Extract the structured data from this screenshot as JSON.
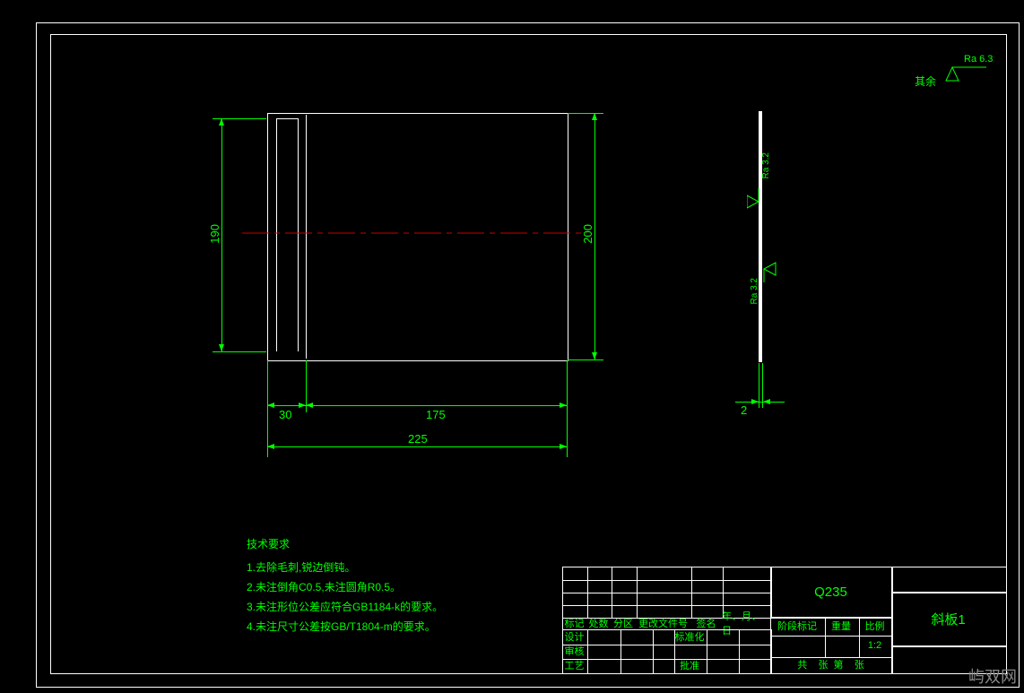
{
  "surface_finish_global": {
    "label": "其余",
    "value": "Ra 6.3"
  },
  "dimensions": {
    "height_190": "190",
    "height_200": "200",
    "width_30": "30",
    "width_175": "175",
    "width_225": "225",
    "thickness_2": "2",
    "ra_32_top": "Ra 3.2",
    "ra_32_bottom": "Ra 3.2"
  },
  "tech": {
    "title": "技术要求",
    "n1": "1.去除毛刺,锐边倒钝。",
    "n2": "2.未注倒角C0.5,未注圆角R0.5。",
    "n3": "3.未注形位公差应符合GB1184-k的要求。",
    "n4": "4.未注尺寸公差按GB/T1804-m的要求。"
  },
  "title_block": {
    "material": "Q235",
    "part_name": "斜板1",
    "row_headers": {
      "mark": "标记",
      "qty": "处数",
      "zone": "分区",
      "change_doc": "更改文件号",
      "sign": "签名",
      "date": "年、月、日",
      "design": "设计",
      "standard": "标准化",
      "stage_mark": "阶段标记",
      "weight": "重量",
      "scale": "比例",
      "check": "审核",
      "approve": "批准",
      "process": "工艺",
      "scale_val": "1:2",
      "sheet": "共    张  第    张"
    }
  },
  "watermark": "屿双网"
}
